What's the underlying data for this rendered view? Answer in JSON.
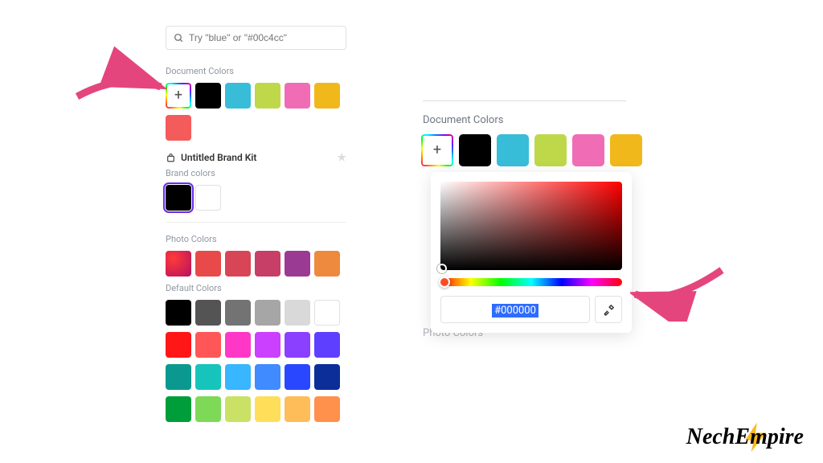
{
  "search": {
    "placeholder": "Try \"blue\" or \"#00c4cc\""
  },
  "sections": {
    "doc_colors": "Document Colors",
    "brand_kit": "Untitled Brand Kit",
    "brand_colors": "Brand colors",
    "photo_colors": "Photo Colors",
    "default_colors": "Default Colors"
  },
  "left": {
    "document_colors": [
      "#000000",
      "#38bdd8",
      "#bfd84a",
      "#f06db6",
      "#f0b81a"
    ],
    "document_colors_row2": [
      "#f45b5b"
    ],
    "brand_colors": [
      "#000000",
      "#ffffff"
    ],
    "photo_colors": [
      "gradient",
      "#e84a4a",
      "#d84556",
      "#c73e66",
      "#9a3a93",
      "#ee8a3d"
    ],
    "default_colors": [
      [
        "#000000",
        "#545454",
        "#737373",
        "#a6a6a6",
        "#d9d9d9",
        "#ffffff"
      ],
      [
        "#ff1616",
        "#ff5757",
        "#ff37c7",
        "#cb3fff",
        "#8b3fff",
        "#5f3fff"
      ],
      [
        "#0b998f",
        "#16c4bc",
        "#38b6ff",
        "#3f8bff",
        "#2947ff",
        "#0b2e99"
      ],
      [
        "#009e3a",
        "#7ed957",
        "#c9e265",
        "#ffde59",
        "#ffbd59",
        "#ff914d"
      ]
    ]
  },
  "right": {
    "document_colors": [
      "#000000",
      "#38bdd8",
      "#bfd84a",
      "#f06db6",
      "#f0b81a"
    ],
    "photo_colors_label": "Photo Colors"
  },
  "picker": {
    "hex": "#000000"
  },
  "logo": {
    "text": "NechEmpire"
  }
}
